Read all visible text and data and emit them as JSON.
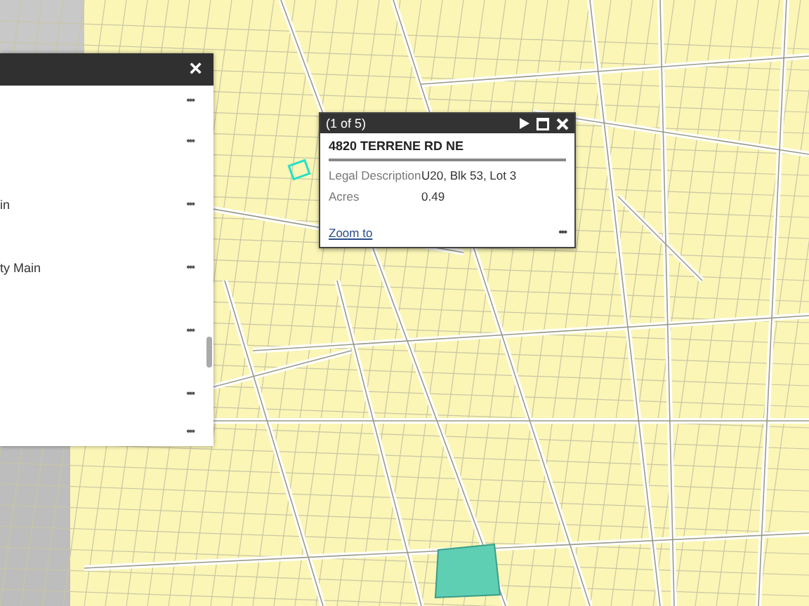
{
  "results_panel": {
    "close": "×",
    "rows": [
      {
        "menu": "•••"
      },
      {
        "menu": "•••"
      },
      {
        "text": "in",
        "menu": "•••"
      },
      {
        "text": "ty Main",
        "menu": "•••"
      },
      {
        "menu": "•••"
      },
      {
        "menu": "•••"
      },
      {
        "menu": "•••"
      }
    ]
  },
  "popup": {
    "counter": "(1 of 5)",
    "title": "4820 TERRENE RD NE",
    "fields": [
      {
        "label": "Legal Description",
        "value": "U20, Blk 53, Lot 3"
      },
      {
        "label": "Acres",
        "value": "0.49"
      }
    ],
    "link": "Zoom to",
    "menu": "•••"
  }
}
